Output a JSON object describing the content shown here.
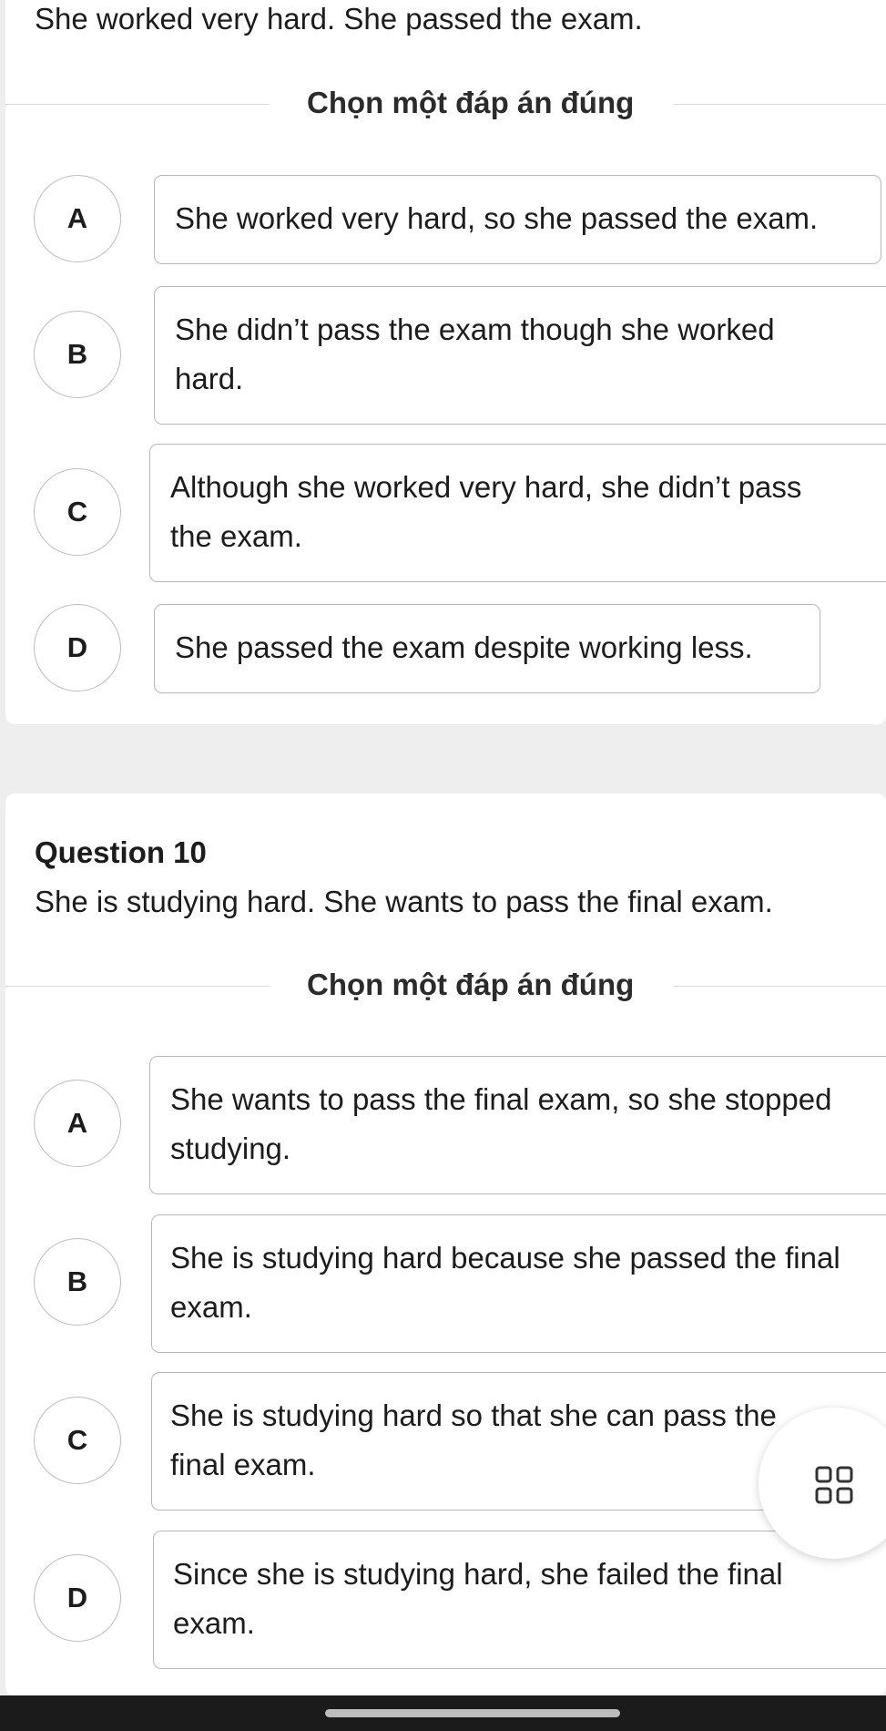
{
  "question9": {
    "text": "She worked very hard. She passed the exam.",
    "instruction": "Chọn một đáp án đúng",
    "options": [
      {
        "letter": "A",
        "line1": "She worked very hard, so she passed the exam.",
        "line2": ""
      },
      {
        "letter": "B",
        "line1": "She didn’t pass the exam though she worked",
        "line2": "hard."
      },
      {
        "letter": "C",
        "line1": "Although she worked very hard, she didn’t pass",
        "line2": "the exam."
      },
      {
        "letter": "D",
        "line1": "She passed the exam despite working less.",
        "line2": ""
      }
    ]
  },
  "question10": {
    "title": "Question 10",
    "text": "She is studying hard. She wants to pass the final exam.",
    "instruction": "Chọn một đáp án đúng",
    "options": [
      {
        "letter": "A",
        "line1": "She wants to pass the final exam, so she stopped",
        "line2": "studying."
      },
      {
        "letter": "B",
        "line1": "She is studying hard because she passed the final",
        "line2": "exam."
      },
      {
        "letter": "C",
        "line1": "She is studying hard so that she can pass the",
        "line2": "final exam."
      },
      {
        "letter": "D",
        "line1": "Since she is studying hard, she failed the final",
        "line2": "exam."
      }
    ]
  },
  "fab": {
    "icon": "grid-icon"
  }
}
